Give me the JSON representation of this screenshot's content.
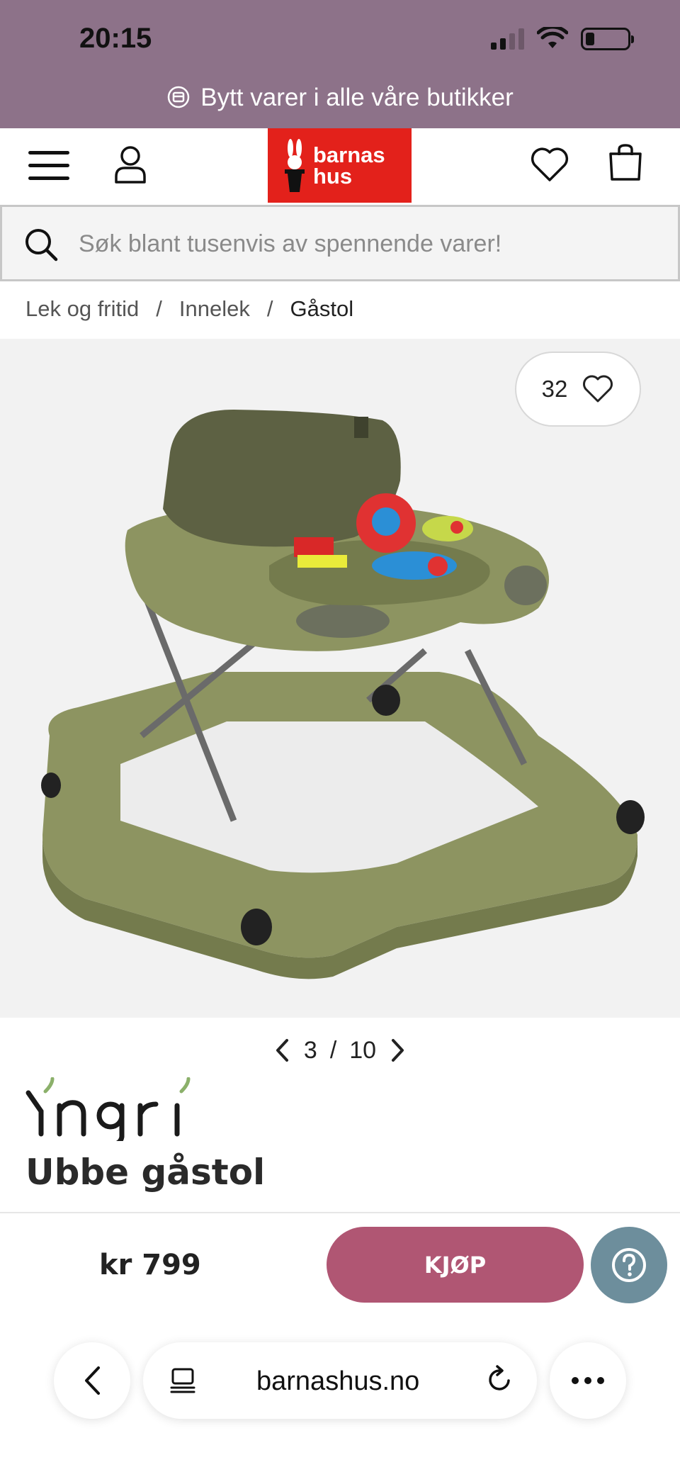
{
  "status_bar": {
    "time": "20:15"
  },
  "promo_banner": {
    "text": "Bytt varer i alle våre butikker"
  },
  "header": {
    "logo_line1": "barnas",
    "logo_line2": "hus"
  },
  "search": {
    "placeholder": "Søk blant tusenvis av spennende varer!"
  },
  "breadcrumb": {
    "items": [
      "Lek og fritid",
      "Innelek",
      "Gåstol"
    ],
    "separator": "/"
  },
  "gallery": {
    "like_count": "32",
    "current_image": "3",
    "separator": "/",
    "total_images": "10"
  },
  "product": {
    "brand": "Yngri",
    "title": "Ubbe gåstol",
    "price": "kr 799"
  },
  "actions": {
    "buy_label": "KJØP"
  },
  "browser": {
    "url": "barnashus.no"
  },
  "colors": {
    "banner": "#8d7289",
    "logo_red": "#e3211b",
    "buy_button": "#b05673",
    "help_button": "#6d8e9c",
    "product_green": "#8d9461"
  }
}
